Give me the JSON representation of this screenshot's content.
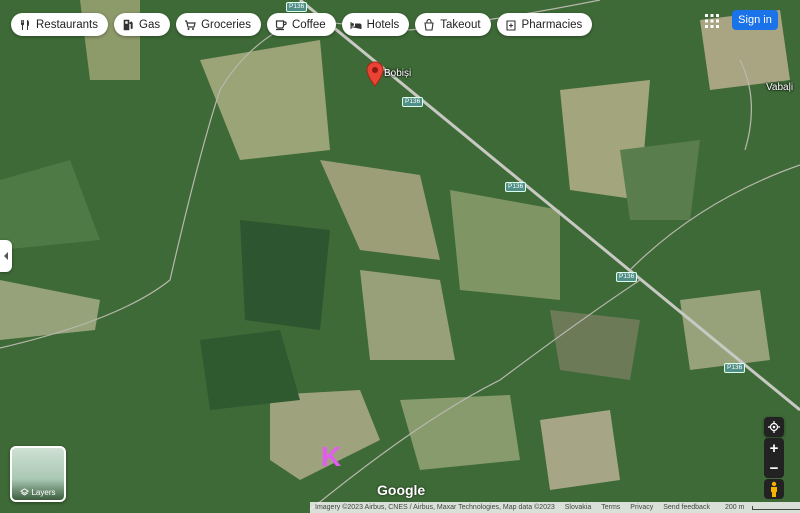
{
  "categories": [
    {
      "label": "Restaurants",
      "icon": "fork-knife-icon"
    },
    {
      "label": "Gas",
      "icon": "gas-pump-icon"
    },
    {
      "label": "Groceries",
      "icon": "cart-icon"
    },
    {
      "label": "Coffee",
      "icon": "coffee-cup-icon"
    },
    {
      "label": "Hotels",
      "icon": "bed-icon"
    },
    {
      "label": "Takeout",
      "icon": "takeout-bag-icon"
    },
    {
      "label": "Pharmacies",
      "icon": "pharmacy-icon"
    }
  ],
  "header": {
    "sign_in": "Sign in"
  },
  "places": {
    "pin": "Bobiși",
    "other": "Vabaļi"
  },
  "roads": {
    "main": "P136"
  },
  "overlay_letter": "K",
  "layers": {
    "label": "Layers"
  },
  "zoom": {
    "in": "+",
    "out": "−"
  },
  "google_logo": "Google",
  "footer": {
    "imagery": "Imagery ©2023 Airbus, CNES / Airbus, Maxar Technologies, Map data ©2023",
    "country": "Slovakia",
    "terms": "Terms",
    "privacy": "Privacy",
    "feedback": "Send feedback",
    "scale": "200 m"
  },
  "colors": {
    "accent": "#1a73e8",
    "pin": "#ea4335",
    "overlay_letter": "#e35cf2"
  }
}
